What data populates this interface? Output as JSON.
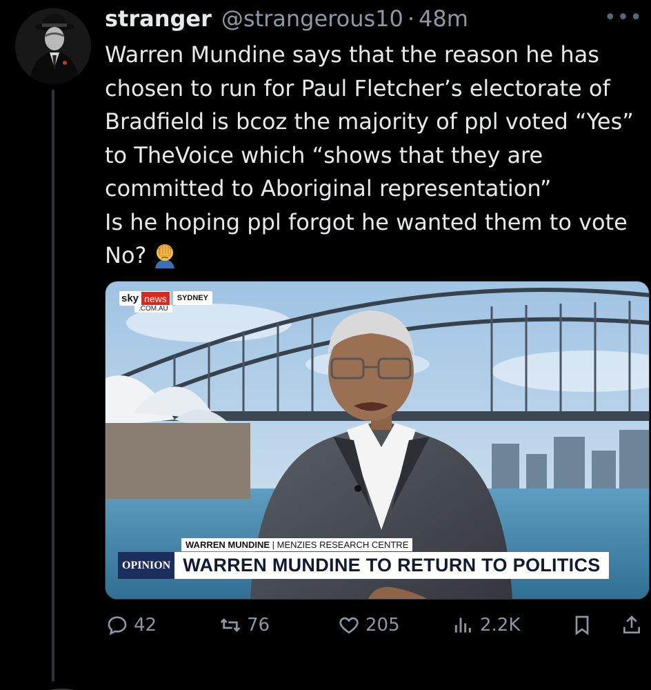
{
  "author": {
    "display_name": "stranger",
    "handle": "@strangerous10",
    "separator": "·",
    "time": "48m"
  },
  "more_menu": "•••",
  "tweet": {
    "lines": [
      "Warren Mundine says that the reason he has",
      "chosen to run for Paul Fletcher’s electorate of",
      "Bradfield is bcoz the majority of ppl voted “Yes”",
      "to TheVoice which “shows that they are",
      "committed to Aboriginal representation”",
      "Is he hoping ppl forgot he wanted them to vote",
      "No?"
    ],
    "emoji": "face-palm-emoji"
  },
  "media": {
    "logo_sky": "sky",
    "logo_news": "news",
    "logo_domain": ".COM.AU",
    "logo_region": "SYDNEY",
    "name_strap_name": "WARREN MUNDINE",
    "name_strap_sep": " | ",
    "name_strap_org": "MENZIES RESEARCH CENTRE",
    "tag": "OPINION",
    "headline": "WARREN MUNDINE TO RETURN TO POLITICS"
  },
  "actions": {
    "replies": "42",
    "reposts": "76",
    "likes": "205",
    "views": "2.2K"
  },
  "colors": {
    "background": "#000000",
    "text": "#e7e9ea",
    "muted": "#8b98a5",
    "sky_red": "#e1251b",
    "opinion_navy": "#1c2e5c"
  }
}
